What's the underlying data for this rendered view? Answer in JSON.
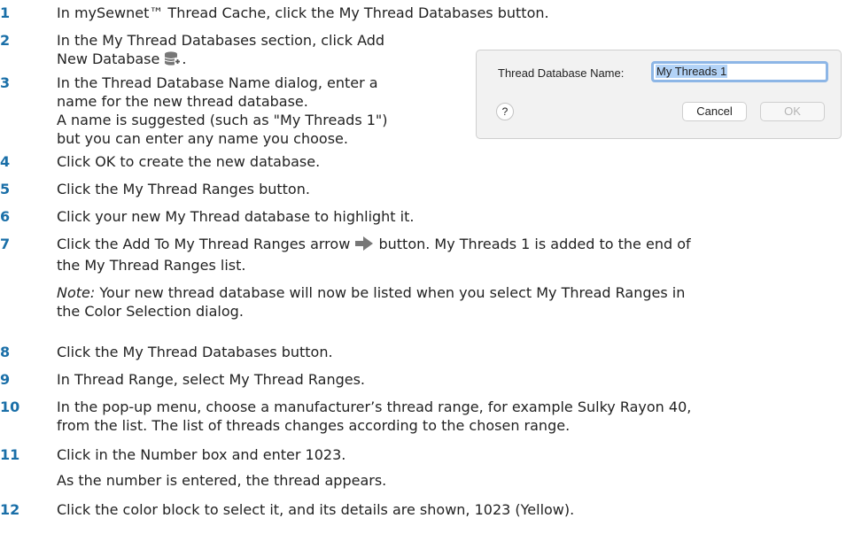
{
  "steps": [
    {
      "number": "1",
      "lines": [
        "In mySewnet™  Thread Cache, click the My Thread Databases button."
      ]
    },
    {
      "number": "2",
      "lines": [
        "In the My Thread Databases section, click Add",
        "New Database"
      ],
      "icon": "database-add-icon",
      "after_icon": "."
    },
    {
      "number": "3",
      "lines": [
        "In the Thread Database Name dialog, enter a",
        "name for the new thread database.",
        "A name is suggested (such as \"My Threads 1\")",
        "but you can enter any name you choose."
      ]
    },
    {
      "number": "4",
      "lines": [
        "Click OK to create the new database."
      ]
    },
    {
      "number": "5",
      "lines": [
        "Click the My Thread Ranges button."
      ]
    },
    {
      "number": "6",
      "lines": [
        "Click your new My Thread database to highlight it."
      ]
    },
    {
      "number": "7",
      "line1_before": "Click the Add To My Thread Ranges arrow",
      "line1_after": "button. My Threads 1 is added to the end of",
      "line2": "the My Thread Ranges list.",
      "icon": "right-arrow-icon",
      "note_label": "Note:",
      "note_line1": "Your new thread database will now be listed when you select My Thread Ranges in",
      "note_line2": "the Color Selection dialog."
    },
    {
      "number": "8",
      "lines": [
        "Click the My Thread Databases button."
      ]
    },
    {
      "number": "9",
      "lines": [
        "In Thread Range, select My Thread Ranges."
      ]
    },
    {
      "number": "10",
      "lines": [
        "In the pop-up menu, choose a manufacturer’s thread range, for example Sulky Rayon 40,",
        "from the list. The list of threads changes according to the chosen range."
      ]
    },
    {
      "number": "11",
      "lines": [
        "Click in the Number box and enter 1023.",
        "As the number is entered, the thread appears."
      ]
    },
    {
      "number": "12",
      "lines": [
        "Click the color block to select it, and its details are shown, 1023 (Yellow)."
      ]
    }
  ],
  "dialog": {
    "label": "Thread Database Name:",
    "input_value": "My Threads 1",
    "help": "?",
    "cancel": "Cancel",
    "ok": "OK"
  },
  "colors": {
    "step_number": "#1a6fa8",
    "icon": "#777777"
  }
}
